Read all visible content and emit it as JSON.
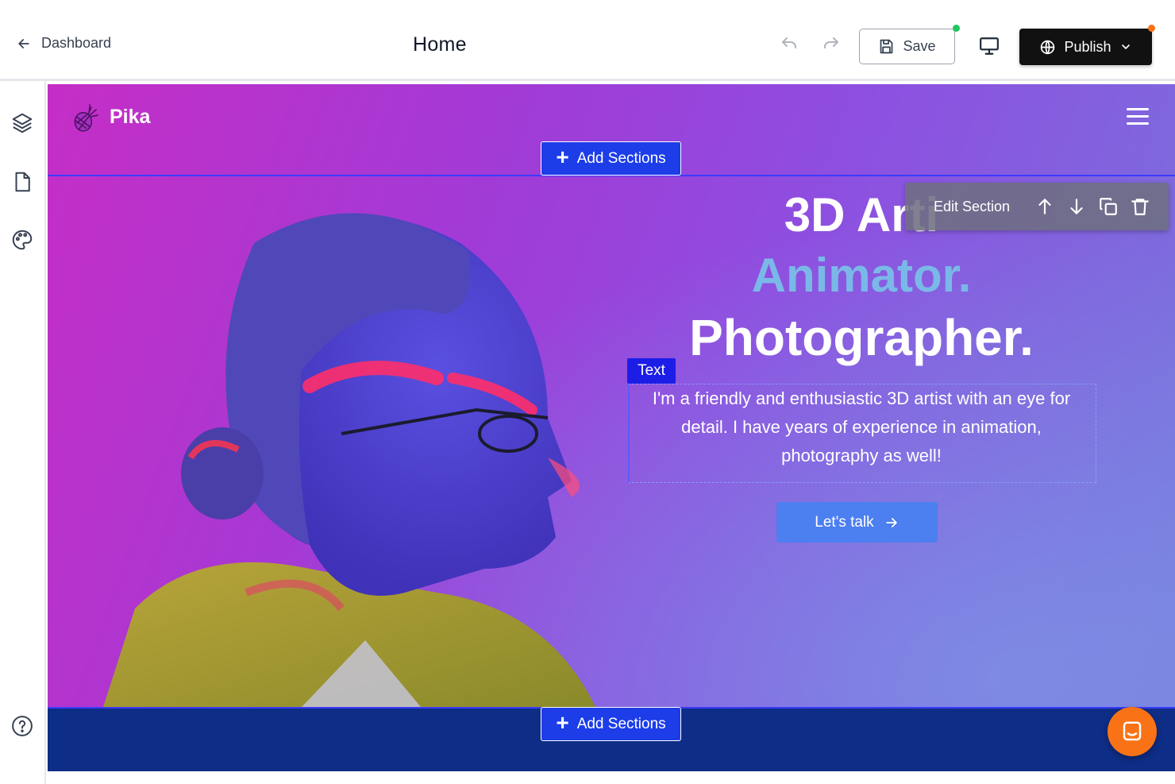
{
  "header": {
    "back_label": "Dashboard",
    "page_title": "Home",
    "save_label": "Save",
    "publish_label": "Publish",
    "icons": [
      "arrow-left-icon",
      "undo-icon",
      "redo-icon",
      "save-icon",
      "monitor-icon",
      "globe-icon",
      "chevron-down-icon"
    ],
    "save_status_color": "#22c55e",
    "publish_status_color": "#f97316"
  },
  "sidebar": {
    "items": [
      {
        "icon": "layers-icon"
      },
      {
        "icon": "page-icon"
      },
      {
        "icon": "palette-icon"
      },
      {
        "icon": "help-icon"
      }
    ]
  },
  "site": {
    "logo_text": "Pika",
    "add_sections_label": "Add Sections",
    "hero": {
      "line1": "3D Arti",
      "line2": "Animator.",
      "line3": "Photographer.",
      "paragraph": "I'm a friendly and enthusiastic 3D artist with an eye for detail. I have years of experience in animation, photography as well!",
      "cta_label": "Let's talk"
    },
    "text_tag": "Text",
    "edit_section_label": "Edit Section",
    "accent_color": "#1d3de8",
    "footer_color": "#0e2d86"
  },
  "chat": {
    "icon": "chat-icon",
    "color": "#f97316"
  }
}
